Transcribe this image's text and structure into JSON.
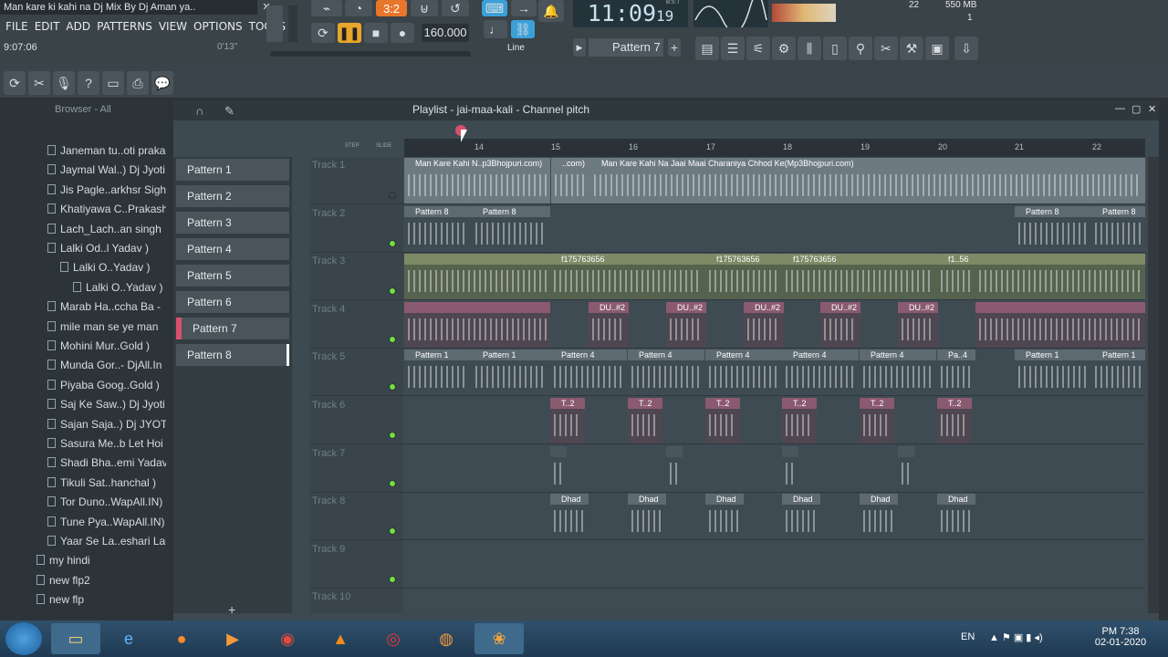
{
  "window": {
    "title": "Man kare ki kahi na Dj Mix By Dj Aman ya..",
    "song_time": "9:07:06",
    "song_pos": "0'13''"
  },
  "menu": [
    "FILE",
    "EDIT",
    "ADD",
    "PATTERNS",
    "VIEW",
    "OPTIONS",
    "TOOLS",
    "?"
  ],
  "transport": {
    "tempo": "160.000",
    "clock": "11:09",
    "clock_sub": "19",
    "clock_label": "B:S:T",
    "pattern": "Pattern 7",
    "snap": "Line",
    "cpu": "22",
    "memory": "550 MB",
    "voices": "1",
    "beat_badge": "3:2"
  },
  "browser": {
    "header": "Browser - All",
    "items": [
      "Janeman tu..oti praka",
      "Jaymal Wal..) Dj Jyoti",
      "Jis Pagle..arkhsr Sigh",
      "Khatiyawa C..Prakash",
      "Lach_Lach..an singh",
      "Lalki Od..l Yadav  )",
      "Lalki O..Yadav  )",
      "Lalki O..Yadav  )",
      "Marab Ha..ccha Ba -",
      "mile man se ye man",
      "Mohini Mur..Gold  )",
      "Munda Gor..- DjAll.In",
      "Piyaba Goog..Gold  )",
      "Saj Ke Saw..) Dj Jyoti",
      "Sajan Saja..) Dj JYOTI",
      "Sasura Me..b Let Hoi",
      "Shadi Bha..emi Yadav",
      "Tikuli Sat..hanchal  )",
      "Tor Duno..WapAll.IN)",
      "Tune Pya..WapAll.IN)",
      "Yaar Se La..eshari Lal",
      "my hindi",
      "new flp2",
      "new flp"
    ]
  },
  "playlist": {
    "title": "Playlist - jai-maa-kali - Channel pitch",
    "step_label": "STEP",
    "slide_label": "SLIDE",
    "patterns": [
      "Pattern 1",
      "Pattern 2",
      "Pattern 3",
      "Pattern 4",
      "Pattern 5",
      "Pattern 6",
      "Pattern 7",
      "Pattern 8"
    ],
    "tracks": [
      "Track 1",
      "Track 2",
      "Track 3",
      "Track 4",
      "Track 5",
      "Track 6",
      "Track 7",
      "Track 8",
      "Track 9",
      "Track 10"
    ],
    "ruler": [
      "14",
      "15",
      "16",
      "17",
      "18",
      "19",
      "20",
      "21",
      "22"
    ],
    "clips": {
      "audio1": "Man Kare Kahi N..p3Bhojpuri.com)",
      "audio2": "..com)",
      "audio3": "Man Kare Kahi Na Jaai Maai Charaniya Chhod Ke(Mp3Bhojpuri.com)",
      "pattern8": "Pattern 8",
      "pitch": "f175763656",
      "pitch_short": "f1..56",
      "du": "DU..#2",
      "pattern1": "Pattern 1",
      "pattern4": "Pattern 4",
      "pa": "Pa..4",
      "t2": "T..2",
      "dhad": "Dhad"
    }
  },
  "taskbar": {
    "lang": "EN",
    "time": "PM 7:38",
    "date": "02-01-2020"
  }
}
